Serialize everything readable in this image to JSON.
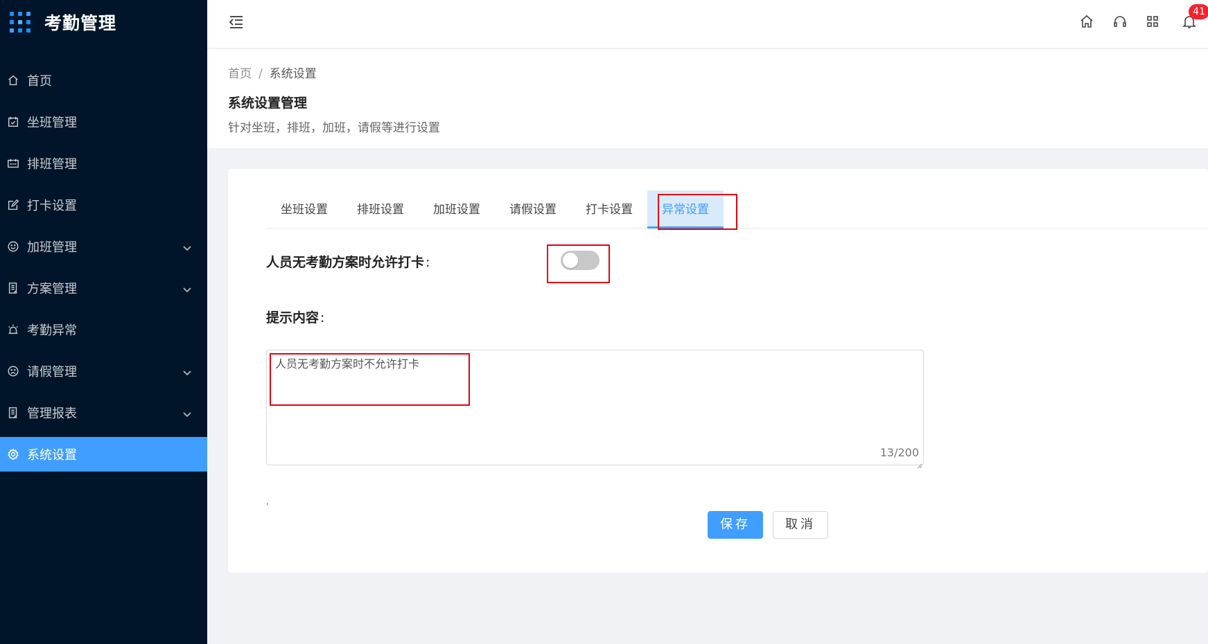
{
  "app": {
    "title": "考勤管理"
  },
  "sidebar": {
    "items": [
      {
        "label": "首页",
        "icon": "home-icon"
      },
      {
        "label": "坐班管理",
        "icon": "calendar-check-icon"
      },
      {
        "label": "排班管理",
        "icon": "calendar-icon"
      },
      {
        "label": "打卡设置",
        "icon": "edit-icon"
      },
      {
        "label": "加班管理",
        "icon": "smile-icon",
        "expandable": true
      },
      {
        "label": "方案管理",
        "icon": "document-icon",
        "expandable": true
      },
      {
        "label": "考勤异常",
        "icon": "alarm-icon"
      },
      {
        "label": "请假管理",
        "icon": "frown-icon",
        "expandable": true
      },
      {
        "label": "管理报表",
        "icon": "document-icon",
        "expandable": true
      },
      {
        "label": "系统设置",
        "icon": "gear-icon",
        "active": true
      }
    ]
  },
  "header": {
    "notification_count": "41",
    "icons": [
      "home-icon",
      "headset-icon",
      "grid-icon",
      "bell-icon"
    ]
  },
  "breadcrumb": {
    "home": "首页",
    "separator": "/",
    "current": "系统设置"
  },
  "page": {
    "title": "系统设置管理",
    "description": "针对坐班，排班，加班，请假等进行设置"
  },
  "tabs": [
    {
      "label": "坐班设置"
    },
    {
      "label": "排班设置"
    },
    {
      "label": "加班设置"
    },
    {
      "label": "请假设置"
    },
    {
      "label": "打卡设置"
    },
    {
      "label": "异常设置",
      "active": true
    }
  ],
  "form": {
    "allow_punch_label": "人员无考勤方案时允许打卡",
    "colon": ":",
    "allow_punch_enabled": false,
    "tip_label": "提示内容",
    "tip_value": "人员无考勤方案时不允许打卡",
    "counter": "13/200",
    "stray_mark": ","
  },
  "buttons": {
    "save": "保存",
    "cancel": "取消"
  },
  "colors": {
    "sidebar_bg": "#001529",
    "accent": "#409eff",
    "badge": "#f5222d",
    "annotation": "#e60012"
  }
}
